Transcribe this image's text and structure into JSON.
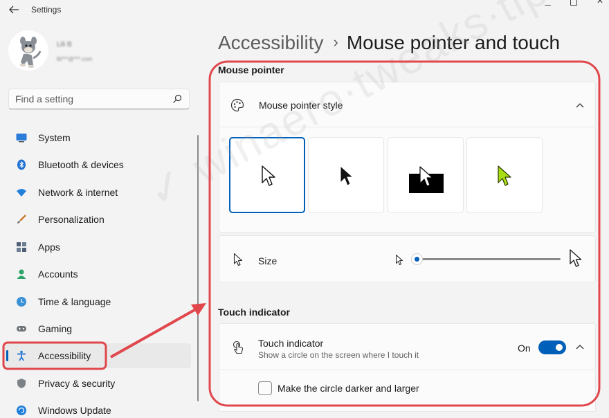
{
  "window": {
    "title": "Settings"
  },
  "user": {
    "name": "Lili B",
    "email": "lili***@***.com"
  },
  "search": {
    "placeholder": "Find a setting"
  },
  "nav": {
    "items": [
      {
        "label": "System",
        "icon": "system-icon"
      },
      {
        "label": "Bluetooth & devices",
        "icon": "bluetooth-icon"
      },
      {
        "label": "Network & internet",
        "icon": "network-icon"
      },
      {
        "label": "Personalization",
        "icon": "brush-icon"
      },
      {
        "label": "Apps",
        "icon": "apps-icon"
      },
      {
        "label": "Accounts",
        "icon": "accounts-icon"
      },
      {
        "label": "Time & language",
        "icon": "globe-clock-icon"
      },
      {
        "label": "Gaming",
        "icon": "gamepad-icon"
      },
      {
        "label": "Accessibility",
        "icon": "accessibility-icon",
        "selected": true
      },
      {
        "label": "Privacy & security",
        "icon": "shield-icon"
      },
      {
        "label": "Windows Update",
        "icon": "update-icon"
      }
    ]
  },
  "header": {
    "parent": "Accessibility",
    "separator": "›",
    "current": "Mouse pointer and touch"
  },
  "mouse_pointer": {
    "section_title": "Mouse pointer",
    "style_card": {
      "title": "Mouse pointer style",
      "icon": "palette-icon",
      "expanded": true
    },
    "style_options": [
      {
        "name": "white",
        "selected": true
      },
      {
        "name": "black",
        "selected": false
      },
      {
        "name": "inverted",
        "selected": false
      },
      {
        "name": "custom",
        "color": "#a8dd14",
        "selected": false
      }
    ],
    "size": {
      "title": "Size",
      "icon": "pointer-icon",
      "value_fraction": 0.0
    }
  },
  "touch": {
    "section_title": "Touch indicator",
    "card": {
      "title": "Touch indicator",
      "subtitle": "Show a circle on the screen where I touch it",
      "icon": "touch-icon",
      "toggle_label": "On",
      "toggle_on": true,
      "expanded": true
    },
    "darker_option": {
      "label": "Make the circle darker and larger",
      "checked": false
    }
  },
  "colors": {
    "accent": "#005fb8",
    "annotation": "#e0474c"
  }
}
